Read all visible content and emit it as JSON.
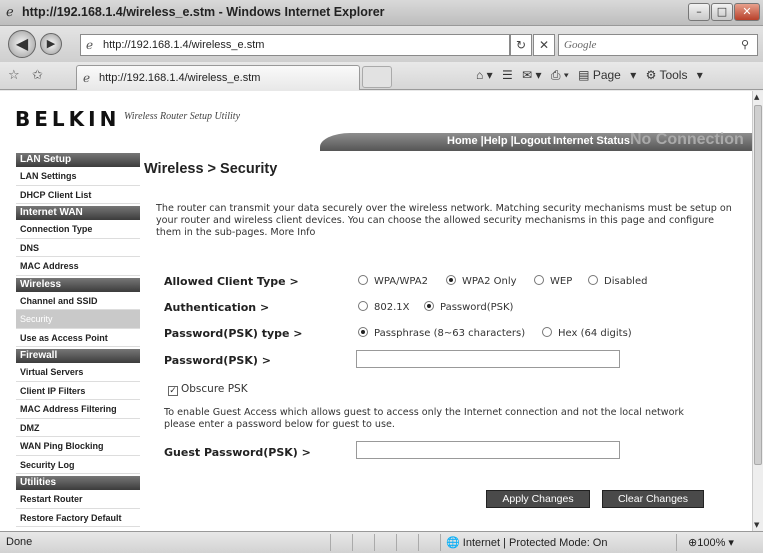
{
  "window": {
    "title": "http://192.168.1.4/wireless_e.stm - Windows Internet Explorer"
  },
  "addressbar": {
    "url": "http://192.168.1.4/wireless_e.stm",
    "search_placeholder": "Google"
  },
  "tab": {
    "label": "http://192.168.1.4/wireless_e.stm"
  },
  "commands": {
    "page": "Page",
    "tools": "Tools"
  },
  "header": {
    "logo": "BELKIN",
    "tagline": "Wireless Router Setup Utility",
    "links": "Home |Help |Logout",
    "status_label": "Internet Status:",
    "status_value": "No Connection"
  },
  "sidebar": {
    "sections": [
      {
        "title": "LAN Setup",
        "items": [
          "LAN Settings",
          "DHCP Client List"
        ]
      },
      {
        "title": "Internet WAN",
        "items": [
          "Connection Type",
          "DNS",
          "MAC Address"
        ]
      },
      {
        "title": "Wireless",
        "items": [
          "Channel and SSID",
          "Security",
          "Use as Access Point"
        ]
      },
      {
        "title": "Firewall",
        "items": [
          "Virtual Servers",
          "Client IP Filters",
          "MAC Address Filtering",
          "DMZ",
          "WAN Ping Blocking",
          "Security Log"
        ]
      },
      {
        "title": "Utilities",
        "items": [
          "Restart Router",
          "Restore Factory Default"
        ]
      }
    ],
    "active_item": "Security"
  },
  "main": {
    "title": "Wireless > Security",
    "intro": "The router can transmit your data securely over the wireless network. Matching security mechanisms must be setup on your router and wireless client devices. You can choose the allowed security mechanisms in this page and configure them in the sub-pages. More Info",
    "client_type": {
      "label": "Allowed Client Type >",
      "options": [
        "WPA/WPA2",
        "WPA2 Only",
        "WEP",
        "Disabled"
      ],
      "selected": "WPA2 Only"
    },
    "authentication": {
      "label": "Authentication >",
      "options": [
        "802.1X",
        "Password(PSK)"
      ],
      "selected": "Password(PSK)"
    },
    "psk_type": {
      "label": "Password(PSK) type >",
      "options": [
        "Passphrase (8~63 characters)",
        "Hex (64 digits)"
      ],
      "selected": "Passphrase (8~63 characters)"
    },
    "psk": {
      "label": "Password(PSK) >",
      "value": ""
    },
    "obscure": {
      "label": "Obscure PSK",
      "checked": true
    },
    "guest_note": "To enable Guest Access which allows guest to access only the Internet connection and not the local network please enter a password below for guest to use.",
    "guest_psk": {
      "label": "Guest Password(PSK) >",
      "value": ""
    },
    "apply_label": "Apply Changes",
    "clear_label": "Clear Changes"
  },
  "statusbar": {
    "left": "Done",
    "zone": "Internet | Protected Mode: On",
    "zoom": "100%"
  }
}
